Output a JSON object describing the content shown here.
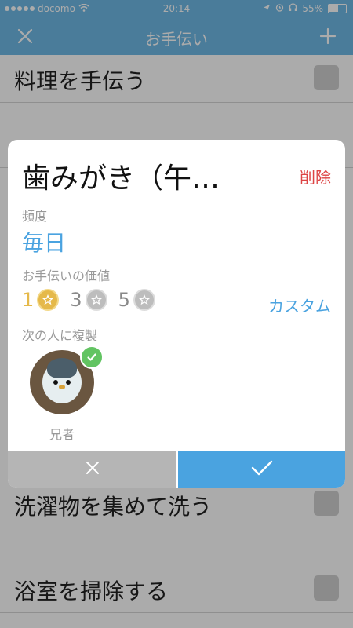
{
  "status_bar": {
    "carrier": "docomo",
    "time": "20:14",
    "battery": "55%",
    "battery_level": 0.55
  },
  "nav": {
    "title": "お手伝い",
    "close_icon": "close-icon",
    "add_icon": "plus-icon"
  },
  "list": {
    "items": [
      {
        "label": "料理を手伝う"
      },
      {
        "label": "洗濯物を集めて洗う"
      },
      {
        "label": "浴室を掃除する"
      }
    ]
  },
  "modal": {
    "title": "歯みがき（午…",
    "delete_label": "削除",
    "frequency_label": "頻度",
    "frequency_value": "毎日",
    "value_label": "お手伝いの価値",
    "values": [
      {
        "number": "1",
        "selected": true
      },
      {
        "number": "3",
        "selected": false
      },
      {
        "number": "5",
        "selected": false
      }
    ],
    "custom_label": "カスタム",
    "copy_label": "次の人に複製",
    "member": {
      "name": "兄者",
      "checked": true
    },
    "cancel_icon": "close-icon",
    "confirm_icon": "checkmark-icon"
  },
  "colors": {
    "accent": "#4aa3e0",
    "header": "#6fb9e6",
    "delete": "#dd4444",
    "gold": "#e5b94a",
    "silver": "#bdbdbd",
    "check": "#62c462"
  }
}
